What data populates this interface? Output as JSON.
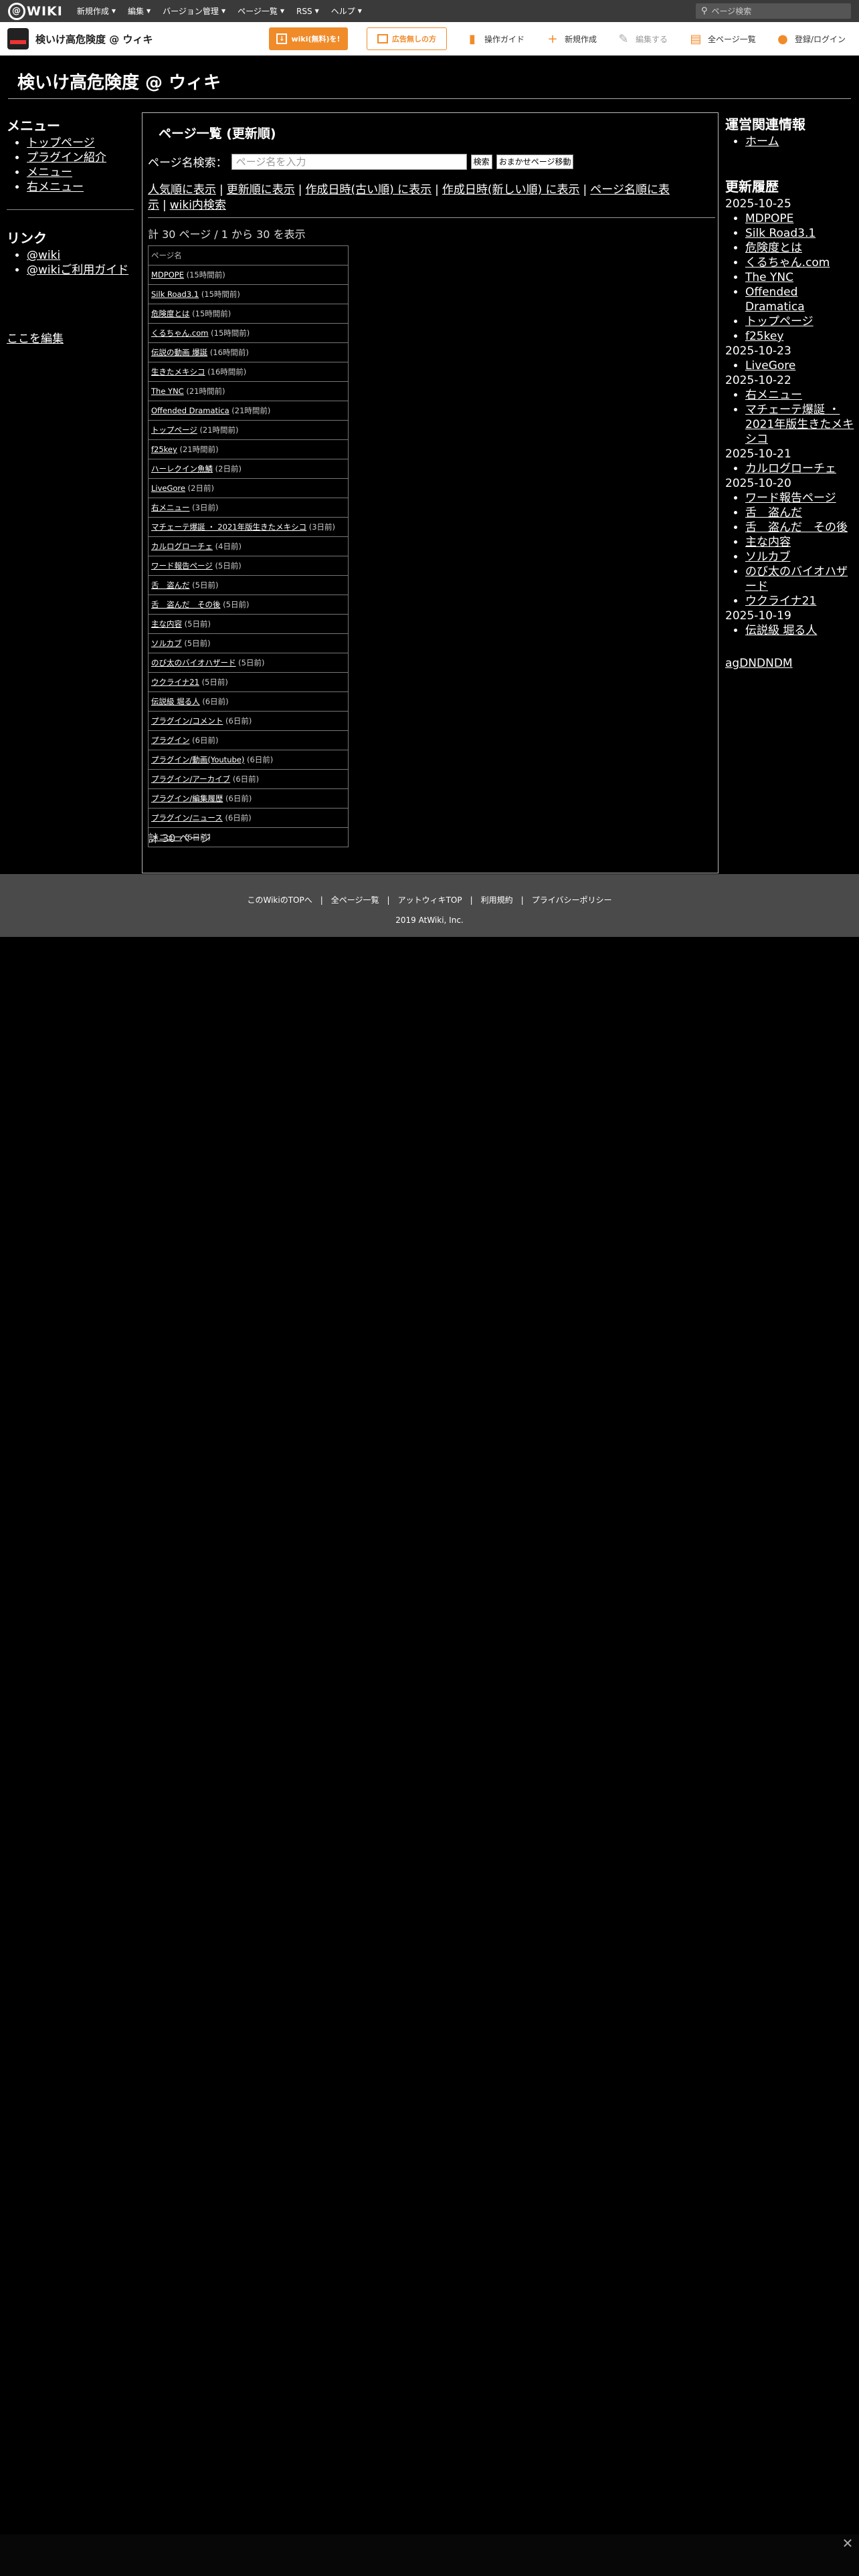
{
  "topbar": {
    "logo_text": "WIKI",
    "menu": [
      {
        "label": "新規作成"
      },
      {
        "label": "編集"
      },
      {
        "label": "バージョン管理"
      },
      {
        "label": "ページ一覧"
      },
      {
        "label": "RSS"
      },
      {
        "label": "ヘルプ"
      }
    ],
    "search_placeholder": "ページ検索"
  },
  "subbar": {
    "site_name": "検いけ高危険度 @ ウィキ",
    "wiki_button": "wiki(無料)を!",
    "ad_free_button": "広告無しの方",
    "tools": [
      {
        "label": "操作ガイド"
      },
      {
        "label": "新規作成"
      },
      {
        "label": "編集する"
      },
      {
        "label": "全ページ一覧"
      },
      {
        "label": "登録/ログイン"
      }
    ]
  },
  "header": {
    "title": "検いけ高危険度 @ ウィキ"
  },
  "left": {
    "menu_title": "メニュー",
    "menu_items": [
      "トップページ",
      "プラグイン紹介",
      "メニュー",
      "右メニュー"
    ],
    "links_title": "リンク",
    "link_items": [
      "@wiki",
      "@wikiご利用ガイド"
    ],
    "edit_link": "ここを編集"
  },
  "main": {
    "title": "ページ一覧 (更新順)",
    "search_label": "ページ名検索：",
    "search_placeholder": "ページ名を入力",
    "search_button": "検索",
    "random_button": "おまかせページ移動",
    "sort_links": [
      "人気順に表示",
      "更新順に表示",
      "作成日時(古い順) に表示",
      "作成日時(新しい順) に表示",
      "ページ名順に表示",
      "wiki内検索"
    ],
    "count_text": "計 30 ページ / 1 から 30 を表示",
    "table_header": "ページ名",
    "pages": [
      {
        "name": "MDPOPE",
        "age": "(15時間前)"
      },
      {
        "name": "Silk Road3.1",
        "age": "(15時間前)"
      },
      {
        "name": "危険度とは",
        "age": "(15時間前)"
      },
      {
        "name": "くるちゃん.com",
        "age": "(15時間前)"
      },
      {
        "name": "伝説の動画 爆誕",
        "age": "(16時間前)"
      },
      {
        "name": "生きたメキシコ",
        "age": "(16時間前)"
      },
      {
        "name": "The YNC",
        "age": "(21時間前)"
      },
      {
        "name": "Offended Dramatica",
        "age": "(21時間前)"
      },
      {
        "name": "トップページ",
        "age": "(21時間前)"
      },
      {
        "name": "f25key",
        "age": "(21時間前)"
      },
      {
        "name": "ハーレクイン魚鱗",
        "age": "(2日前)"
      },
      {
        "name": "LiveGore",
        "age": "(2日前)"
      },
      {
        "name": "右メニュー",
        "age": "(3日前)"
      },
      {
        "name": "マチェーテ爆誕 ・ 2021年版生きたメキシコ",
        "age": "(3日前)"
      },
      {
        "name": "カルログローチェ",
        "age": "(4日前)"
      },
      {
        "name": "ワード報告ページ",
        "age": "(5日前)"
      },
      {
        "name": "舌　盗んだ",
        "age": "(5日前)"
      },
      {
        "name": "舌　盗んだ　その後",
        "age": "(5日前)"
      },
      {
        "name": "主な内容",
        "age": "(5日前)"
      },
      {
        "name": "ソルカブ",
        "age": "(5日前)"
      },
      {
        "name": "のび太のバイオハザード",
        "age": "(5日前)"
      },
      {
        "name": "ウクライナ21",
        "age": "(5日前)"
      },
      {
        "name": "伝説級 堀る人",
        "age": "(6日前)"
      },
      {
        "name": "プラグイン/コメント",
        "age": "(6日前)"
      },
      {
        "name": "プラグイン",
        "age": "(6日前)"
      },
      {
        "name": "プラグイン/動画(Youtube)",
        "age": "(6日前)"
      },
      {
        "name": "プラグイン/アーカイブ",
        "age": "(6日前)"
      },
      {
        "name": "プラグイン/編集履歴",
        "age": "(6日前)"
      },
      {
        "name": "プラグイン/ニュース",
        "age": "(6日前)"
      },
      {
        "name": "メニュー",
        "age": "(6日前)"
      }
    ],
    "total_text": "計 30 ページ"
  },
  "right": {
    "ops_title": "運営関連情報",
    "ops_items": [
      "ホーム"
    ],
    "history_title": "更新履歴",
    "history": [
      {
        "date": "2025-10-25",
        "items": [
          "MDPOPE",
          "Silk Road3.1",
          "危険度とは",
          "くるちゃん.com",
          "The YNC",
          "Offended Dramatica",
          "トップページ",
          "f25key"
        ]
      },
      {
        "date": "2025-10-23",
        "items": [
          "LiveGore"
        ]
      },
      {
        "date": "2025-10-22",
        "items": [
          "右メニュー",
          "マチェーテ爆誕 ・ 2021年版生きたメキシコ"
        ]
      },
      {
        "date": "2025-10-21",
        "items": [
          "カルログローチェ"
        ]
      },
      {
        "date": "2025-10-20",
        "items": [
          "ワード報告ページ",
          "舌　盗んだ",
          "舌　盗んだ　その後",
          "主な内容",
          "ソルカブ",
          "のび太のバイオハザード",
          "ウクライナ21"
        ]
      },
      {
        "date": "2025-10-19",
        "items": [
          "伝説級 堀る人"
        ]
      }
    ],
    "extra_link": "agDNDNDM"
  },
  "footer": {
    "links": [
      "このWikiのTOPへ",
      "全ページ一覧",
      "アットウィキTOP",
      "利用規約",
      "プライバシーポリシー"
    ],
    "copyright": "2019 AtWiki, Inc."
  },
  "ad": {
    "close_icon": "close-icon"
  }
}
